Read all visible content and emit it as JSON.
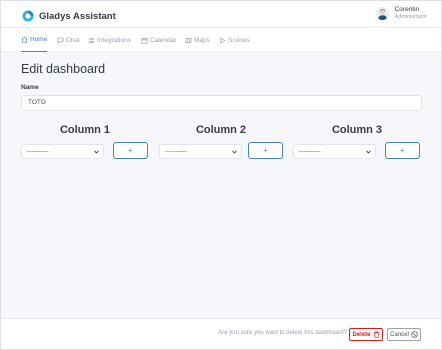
{
  "app": {
    "name": "Gladys Assistant",
    "logo_icon": "gladys-logo-icon"
  },
  "user": {
    "name": "Corentin",
    "role": "Administrator"
  },
  "nav": [
    {
      "label": "Home",
      "icon": "home-icon",
      "active": true
    },
    {
      "label": "Chat",
      "icon": "chat-icon",
      "active": false
    },
    {
      "label": "Integrations",
      "icon": "integrations-icon",
      "active": false
    },
    {
      "label": "Calendar",
      "icon": "calendar-icon",
      "active": false
    },
    {
      "label": "Maps",
      "icon": "map-icon",
      "active": false
    },
    {
      "label": "Scenes",
      "icon": "play-icon",
      "active": false
    }
  ],
  "page": {
    "title": "Edit dashboard"
  },
  "form": {
    "name_label": "Name",
    "name_value": "TOTO"
  },
  "columns": [
    {
      "title": "Column 1",
      "select_value": "----------",
      "add_label": "+"
    },
    {
      "title": "Column 2",
      "select_value": "----------",
      "add_label": "+"
    },
    {
      "title": "Column 3",
      "select_value": "----------",
      "add_label": "+"
    }
  ],
  "footer": {
    "confirm_text": "Are you sure you want to delete this dashboard?",
    "delete_label": "Delete",
    "cancel_label": "Cancel"
  },
  "colors": {
    "accent": "#467fcf",
    "danger": "#cd201f",
    "muted": "#9aa0ac",
    "background": "#f5f7fb"
  }
}
